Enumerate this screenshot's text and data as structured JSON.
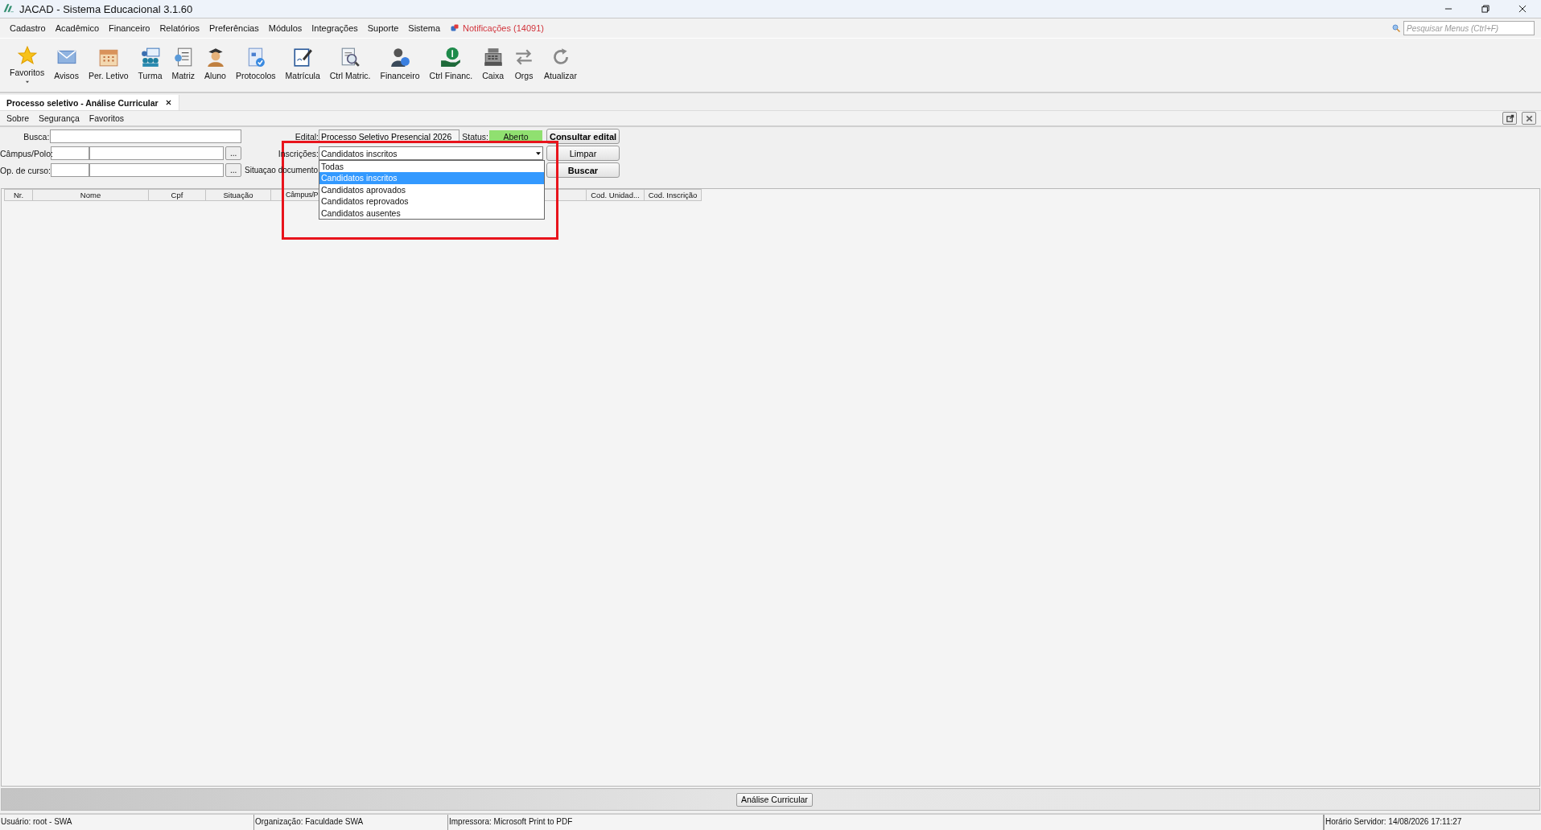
{
  "window": {
    "title": "JACAD - Sistema Educacional 3.1.60"
  },
  "menu_bar": {
    "items": [
      "Cadastro",
      "Acadêmico",
      "Financeiro",
      "Relatórios",
      "Preferências",
      "Módulos",
      "Integrações",
      "Suporte",
      "Sistema"
    ],
    "notifications": "Notificações (14091)",
    "search": {
      "placeholder": "Pesquisar Menus (Ctrl+F)"
    }
  },
  "toolbar": [
    {
      "label": "Favoritos"
    },
    {
      "label": "Avisos"
    },
    {
      "label": "Per. Letivo"
    },
    {
      "label": "Turma"
    },
    {
      "label": "Matriz"
    },
    {
      "label": "Aluno"
    },
    {
      "label": "Protocolos"
    },
    {
      "label": "Matrícula"
    },
    {
      "label": "Ctrl Matric."
    },
    {
      "label": "Financeiro"
    },
    {
      "label": "Ctrl Financ."
    },
    {
      "label": "Caixa"
    },
    {
      "label": "Orgs"
    },
    {
      "label": "Atualizar"
    }
  ],
  "document_tab": {
    "title": "Processo seletivo - Análise Curricular"
  },
  "sub_menu": [
    "Sobre",
    "Segurança",
    "Favoritos"
  ],
  "form": {
    "busca_label": "Busca:",
    "campus_label": "Câmpus/Polo:",
    "curso_label": "Op. de curso:",
    "browse_buttons": [
      "...",
      "..."
    ],
    "edital": {
      "label": "Edital:",
      "value": "Processo Seletivo Presencial 2026"
    },
    "status": {
      "label": "Status:",
      "value": "Aberto"
    },
    "inscricoes": {
      "label": "Inscrições:",
      "value": "Candidatos inscritos",
      "expanded": true,
      "options": [
        {
          "label": "Todas",
          "selected": false
        },
        {
          "label": "Candidatos inscritos",
          "selected": true
        },
        {
          "label": "Candidatos aprovados",
          "selected": false
        },
        {
          "label": "Candidatos reprovados",
          "selected": false
        },
        {
          "label": "Candidatos ausentes",
          "selected": false
        }
      ]
    },
    "situacao_label": "Situaçao documento:",
    "buttons": [
      "Consultar edital",
      "Limpar",
      "Buscar"
    ]
  },
  "table": {
    "columns": [
      "Nr.",
      "Nome",
      "Cpf",
      "Situação",
      "Câmpus/P",
      "Cod. Unidad...",
      "Cod. Inscrição"
    ]
  },
  "bottom_bar": {
    "button": "Análise Curricular"
  },
  "status_bar": [
    "Usuário: root - SWA",
    "Organização: Faculdade SWA",
    "Impressora: Microsoft Print to PDF",
    "Horário Servidor: 14/08/2026 17:11:27"
  ]
}
